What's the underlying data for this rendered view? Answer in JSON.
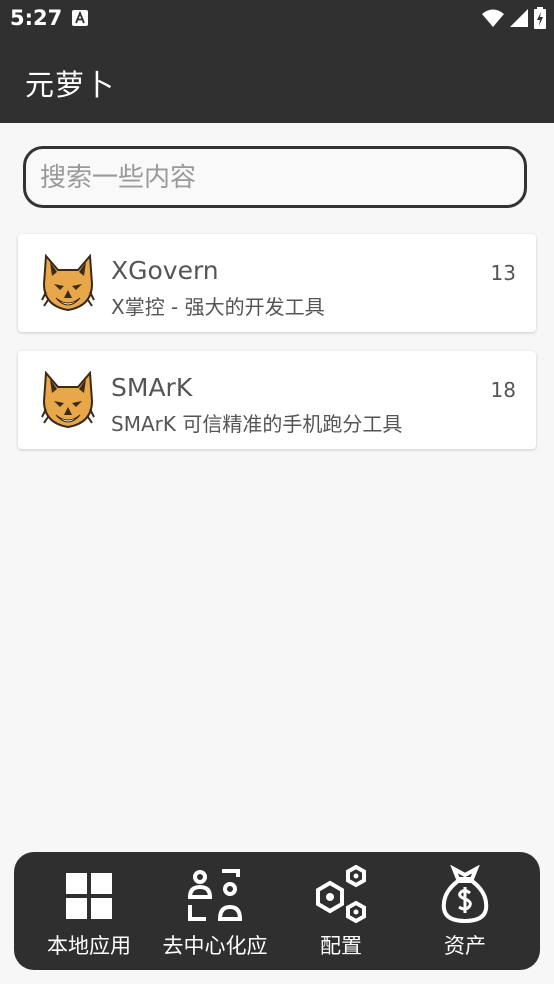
{
  "status_bar": {
    "time": "5:27",
    "icons": [
      "notification-a-icon",
      "wifi-icon",
      "signal-icon",
      "battery-charging-icon"
    ]
  },
  "app_bar": {
    "title": "元萝卜"
  },
  "search": {
    "placeholder": "搜索一些内容",
    "value": ""
  },
  "apps": [
    {
      "name": "XGovern",
      "description": "X掌控 - 强大的开发工具",
      "count": "13",
      "icon": "lynx-logo-icon"
    },
    {
      "name": "SMArK",
      "description": "SMArK 可信精准的手机跑分工具",
      "count": "18",
      "icon": "lynx-logo-icon"
    }
  ],
  "bottom_nav": [
    {
      "label": "本地应用",
      "icon": "grid-apps-icon"
    },
    {
      "label": "去中心化应",
      "icon": "decentralized-icon"
    },
    {
      "label": "配置",
      "icon": "hexagon-settings-icon"
    },
    {
      "label": "资产",
      "icon": "money-bag-icon"
    }
  ],
  "colors": {
    "app_bar_bg": "#303030",
    "page_bg": "#f7f7f7",
    "card_bg": "#ffffff",
    "text_gray": "#555555",
    "logo_orange": "#e8a84a"
  }
}
